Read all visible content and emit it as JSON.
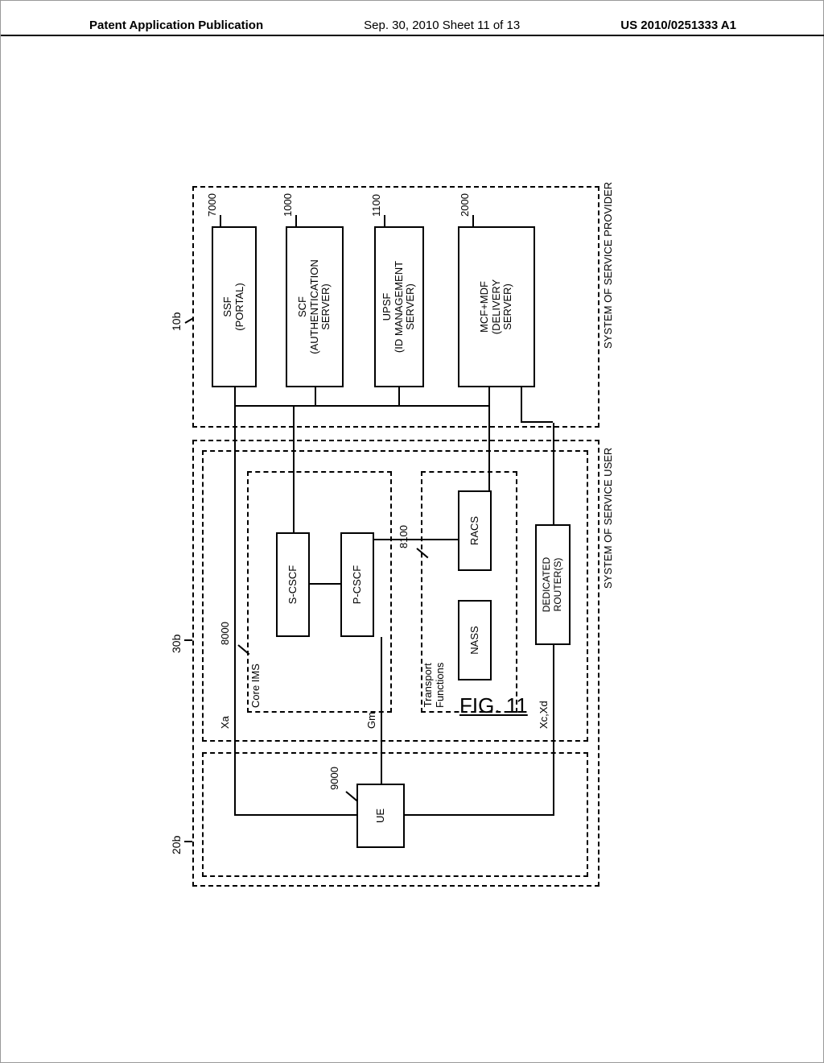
{
  "header": {
    "left": "Patent Application Publication",
    "center": "Sep. 30, 2010  Sheet 11 of 13",
    "right": "US 2010/0251333 A1"
  },
  "figure_caption": "FIG. 11",
  "refs": {
    "r20b": "20b",
    "r30b": "30b",
    "r10b": "10b",
    "r9000": "9000",
    "r8000": "8000",
    "r8100": "8100",
    "r7000": "7000",
    "r1000": "1000",
    "r1100": "1100",
    "r2000": "2000"
  },
  "ifaces": {
    "xa": "Xa",
    "gm": "Gm",
    "xcxd": "Xc,Xd"
  },
  "groups": {
    "core_ims": "Core IMS",
    "transport": "Transport\nFunctions",
    "service_user_outer": "SYSTEM OF SERVICE USER",
    "service_provider": "SYSTEM OF SERVICE PROVIDER"
  },
  "blocks": {
    "ue": "UE",
    "s_cscf": "S-CSCF",
    "p_cscf": "P-CSCF",
    "nass": "NASS",
    "racs": "RACS",
    "dedicated_router": "DEDICATED\nROUTER(S)",
    "ssf": "SSF\n(PORTAL)",
    "scf": "SCF\n(AUTHENTICATION\nSERVER)",
    "upsf": "UPSF\n(ID MANAGEMENT\nSERVER)",
    "mcf_mdf": "MCF+MDF\n(DELIVERY\nSERVER)"
  }
}
